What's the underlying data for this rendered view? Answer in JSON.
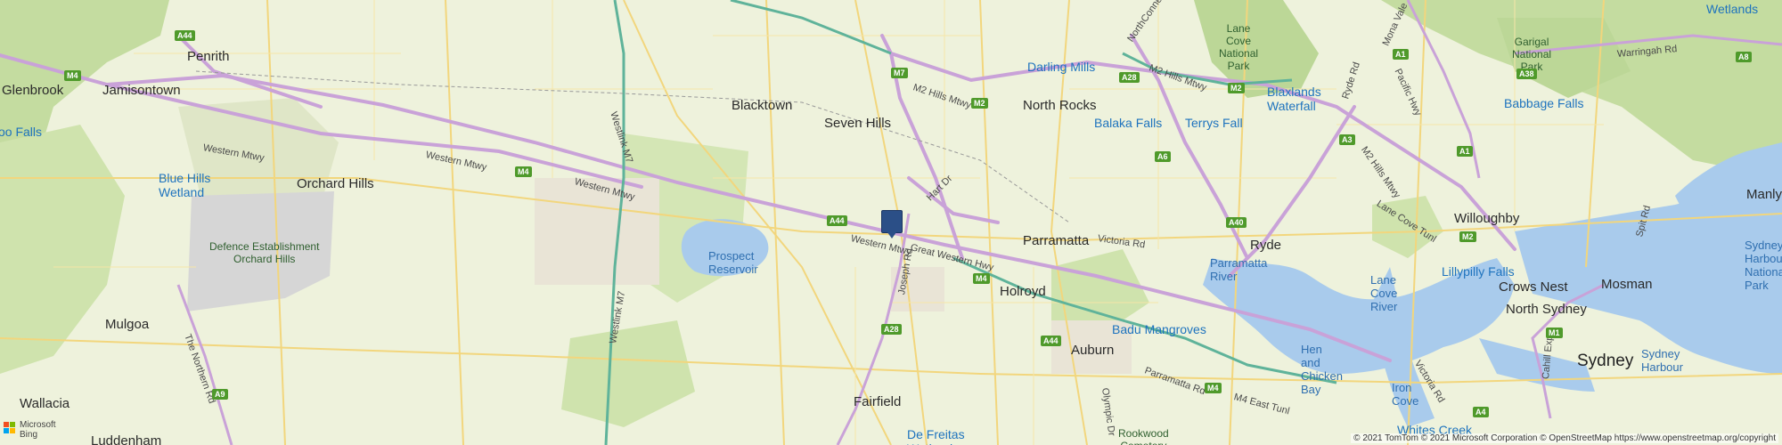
{
  "map": {
    "places": [
      {
        "id": "penrith",
        "name": "Penrith",
        "cls": "city"
      },
      {
        "id": "jamisontown",
        "name": "Jamisontown",
        "cls": "city"
      },
      {
        "id": "glenbrook",
        "name": "Glenbrook",
        "cls": "city"
      },
      {
        "id": "orchard-hills",
        "name": "Orchard Hills",
        "cls": "city"
      },
      {
        "id": "mulgoa",
        "name": "Mulgoa",
        "cls": "city"
      },
      {
        "id": "wallacia",
        "name": "Wallacia",
        "cls": "city"
      },
      {
        "id": "luddenham",
        "name": "Luddenham",
        "cls": "city"
      },
      {
        "id": "blacktown",
        "name": "Blacktown",
        "cls": "city"
      },
      {
        "id": "seven-hills",
        "name": "Seven Hills",
        "cls": "city"
      },
      {
        "id": "north-rocks",
        "name": "North Rocks",
        "cls": "city"
      },
      {
        "id": "parramatta",
        "name": "Parramatta",
        "cls": "city"
      },
      {
        "id": "holroyd",
        "name": "Holroyd",
        "cls": "city"
      },
      {
        "id": "auburn",
        "name": "Auburn",
        "cls": "city"
      },
      {
        "id": "fairfield",
        "name": "Fairfield",
        "cls": "city"
      },
      {
        "id": "ryde",
        "name": "Ryde",
        "cls": "city"
      },
      {
        "id": "willoughby",
        "name": "Willoughby",
        "cls": "city"
      },
      {
        "id": "crows-nest",
        "name": "Crows Nest",
        "cls": "city"
      },
      {
        "id": "north-sydney",
        "name": "North Sydney",
        "cls": "city"
      },
      {
        "id": "mosman",
        "name": "Mosman",
        "cls": "city"
      },
      {
        "id": "manly",
        "name": "Manly",
        "cls": "city"
      },
      {
        "id": "sydney",
        "name": "Sydney",
        "cls": "big"
      }
    ],
    "water_labels": [
      {
        "id": "prospect-reservoir",
        "name": "Prospect\nReservoir"
      },
      {
        "id": "parramatta-river",
        "name": "Parramatta\nRiver"
      },
      {
        "id": "lane-cove-river",
        "name": "Lane\nCove\nRiver"
      },
      {
        "id": "hen-chicken-bay",
        "name": "Hen\nand\nChicken\nBay"
      },
      {
        "id": "iron-cove",
        "name": "Iron\nCove"
      },
      {
        "id": "sydney-harbour",
        "name": "Sydney\nHarbour"
      },
      {
        "id": "sydney-harbour-np",
        "name": "Sydney\nHarbour\nNational\nPark"
      }
    ],
    "park_labels": [
      {
        "id": "defence-orchard-hills",
        "name": "Defence Establishment\nOrchard Hills"
      },
      {
        "id": "lane-cove-np",
        "name": "Lane\nCove\nNational\nPark"
      },
      {
        "id": "garigal-np",
        "name": "Garigal\nNational\nPark"
      },
      {
        "id": "rookwood",
        "name": "Rookwood\nCemetery"
      }
    ],
    "pois": [
      {
        "id": "blue-hills-wetland",
        "name": "Blue Hills\nWetland"
      },
      {
        "id": "darling-mills",
        "name": "Darling Mills"
      },
      {
        "id": "balaka-falls",
        "name": "Balaka Falls"
      },
      {
        "id": "terrys-fall",
        "name": "Terrys Fall"
      },
      {
        "id": "blaxlands-waterfall",
        "name": "Blaxlands\nWaterfall"
      },
      {
        "id": "babbage-falls",
        "name": "Babbage Falls"
      },
      {
        "id": "lillypilly-falls",
        "name": "Lillypilly Falls"
      },
      {
        "id": "badu-mangroves",
        "name": "Badu Mangroves"
      },
      {
        "id": "whites-creek",
        "name": "Whites Creek"
      },
      {
        "id": "de-freitas-wetland",
        "name": "De Freitas\nWetland"
      },
      {
        "id": "wetlands",
        "name": "Wetlands"
      },
      {
        "id": "oo-falls",
        "name": "oo Falls"
      }
    ],
    "road_labels": [
      {
        "id": "western-mtwy-1",
        "name": "Western Mtwy"
      },
      {
        "id": "western-mtwy-2",
        "name": "Western Mtwy"
      },
      {
        "id": "western-mtwy-3",
        "name": "Western Mtwy"
      },
      {
        "id": "western-mtwy-4",
        "name": "Western Mtwy"
      },
      {
        "id": "great-western-hwy",
        "name": "Great Western Hwy"
      },
      {
        "id": "westlink-m7-n",
        "name": "Westlink M7"
      },
      {
        "id": "westlink-m7-s",
        "name": "Westlink M7"
      },
      {
        "id": "the-northern-rd",
        "name": "The Northern Rd"
      },
      {
        "id": "m2-hills-mtwy-1",
        "name": "M2 Hills Mtwy"
      },
      {
        "id": "m2-hills-mtwy-2",
        "name": "M2 Hills Mtwy"
      },
      {
        "id": "m2-hills-mtwy-3",
        "name": "M2 Hills Mtwy"
      },
      {
        "id": "northconnex",
        "name": "NorthConnex Tu"
      },
      {
        "id": "hart-dr",
        "name": "Hart Dr"
      },
      {
        "id": "joseph-rd",
        "name": "Joseph Rd"
      },
      {
        "id": "victoria-rd-1",
        "name": "Victoria Rd"
      },
      {
        "id": "victoria-rd-2",
        "name": "Victoria Rd"
      },
      {
        "id": "parramatta-rd",
        "name": "Parramatta Rd"
      },
      {
        "id": "olympic-dr",
        "name": "Olympic Dr"
      },
      {
        "id": "m4-east-tunl",
        "name": "M4 East Tunl"
      },
      {
        "id": "lane-cove-tunl",
        "name": "Lane Cove Tunl"
      },
      {
        "id": "ryde-rd",
        "name": "Ryde Rd"
      },
      {
        "id": "pacific-hwy",
        "name": "Pacific Hwy"
      },
      {
        "id": "mona-vale",
        "name": "Mona Vale"
      },
      {
        "id": "warringah-rd",
        "name": "Warringah Rd"
      },
      {
        "id": "cahill-exp",
        "name": "Cahill Exp"
      },
      {
        "id": "spit-rd",
        "name": "Spit Rd"
      }
    ],
    "shields": [
      {
        "id": "a44-penrith",
        "text": "A44"
      },
      {
        "id": "m4-glenbrook",
        "text": "M4"
      },
      {
        "id": "m4-western",
        "text": "M4"
      },
      {
        "id": "a44-prospect",
        "text": "A44"
      },
      {
        "id": "m7-north",
        "text": "M7"
      },
      {
        "id": "m2-hills",
        "text": "M2"
      },
      {
        "id": "a28-north",
        "text": "A28"
      },
      {
        "id": "m2-east",
        "text": "M2"
      },
      {
        "id": "a1-north",
        "text": "A1"
      },
      {
        "id": "a6-north",
        "text": "A6"
      },
      {
        "id": "a40-ryde",
        "text": "A40"
      },
      {
        "id": "a3-ryde",
        "text": "A3"
      },
      {
        "id": "a1-east",
        "text": "A1"
      },
      {
        "id": "m2-lanecove",
        "text": "M2"
      },
      {
        "id": "a38",
        "text": "A38"
      },
      {
        "id": "a8",
        "text": "A8"
      },
      {
        "id": "m4-holroyd",
        "text": "M4"
      },
      {
        "id": "a28-south",
        "text": "A28"
      },
      {
        "id": "a9",
        "text": "A9"
      },
      {
        "id": "a44-auburn",
        "text": "A44"
      },
      {
        "id": "m4-east",
        "text": "M4"
      },
      {
        "id": "a4",
        "text": "A4"
      },
      {
        "id": "m1",
        "text": "M1"
      }
    ],
    "copyright": "© 2021 TomTom © 2021 Microsoft Corporation © OpenStreetMap https://www.openstreetmap.org/copyright",
    "brand": {
      "line1": "Microsoft",
      "line2": "Bing"
    },
    "colors": {
      "land": "#eef2dc",
      "park": "#c9e0a8",
      "forest": "#b5d48f",
      "water": "#a9cbec",
      "motorway": "#c9a2d8",
      "major": "#f2d67d",
      "urban": "#e6e1d3",
      "marker": "#2b4f87"
    }
  }
}
